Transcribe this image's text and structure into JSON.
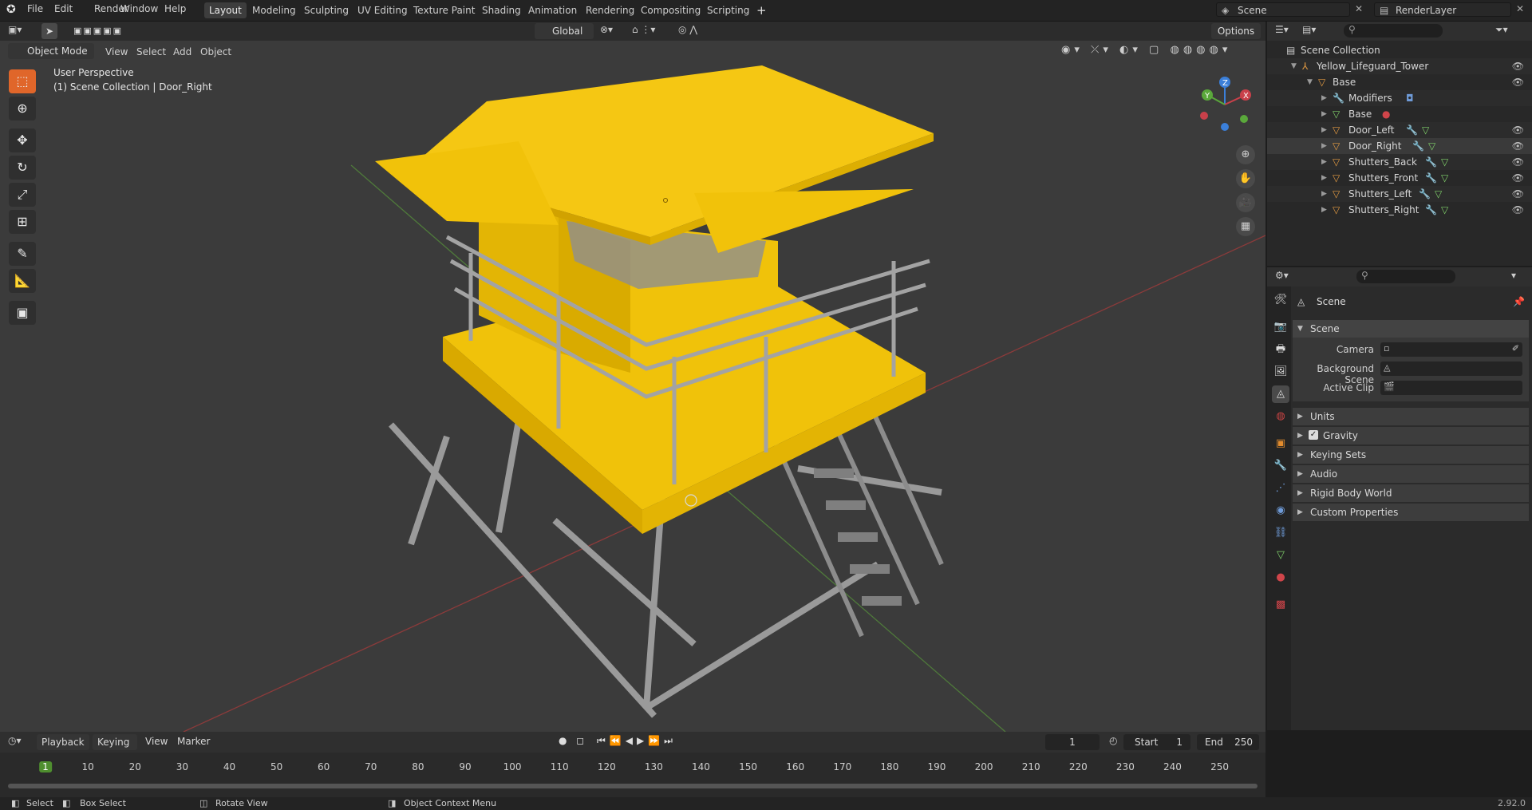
{
  "menu": {
    "items": [
      "File",
      "Edit",
      "Render",
      "Window",
      "Help"
    ]
  },
  "workspaces": {
    "tabs": [
      "Layout",
      "Modeling",
      "Sculpting",
      "UV Editing",
      "Texture Paint",
      "Shading",
      "Animation",
      "Rendering",
      "Compositing",
      "Scripting"
    ],
    "active": "Layout",
    "add": "+"
  },
  "scene_field": "Scene",
  "view_layer_field": "RenderLayer",
  "viewport_header": {
    "mode": "Object Mode",
    "menus": [
      "View",
      "Select",
      "Add",
      "Object"
    ],
    "transform_orientation": "Global",
    "options": "Options"
  },
  "viewport_overlay": {
    "perspective": "User Perspective",
    "collection": "(1) Scene Collection | Door_Right"
  },
  "gizmo": {
    "x": "X",
    "y": "Y",
    "z": "Z"
  },
  "outliner": {
    "rows": [
      {
        "label": "Scene Collection",
        "indent": 0,
        "eye": false,
        "color": "#c8c8c8"
      },
      {
        "label": "Yellow_Lifeguard_Tower",
        "indent": 1,
        "eye": true,
        "color": "#e29a42"
      },
      {
        "label": "Base",
        "indent": 2,
        "eye": true,
        "color": "#e29a42"
      },
      {
        "label": "Modifiers",
        "indent": 3,
        "eye": false,
        "color": "#6f9bd8"
      },
      {
        "label": "Base",
        "indent": 3,
        "eye": false,
        "color": "#7fcf6a"
      },
      {
        "label": "Door_Left",
        "indent": 3,
        "eye": true,
        "color": "#e29a42"
      },
      {
        "label": "Door_Right",
        "indent": 3,
        "eye": true,
        "color": "#e29a42"
      },
      {
        "label": "Shutters_Back",
        "indent": 3,
        "eye": true,
        "color": "#e29a42"
      },
      {
        "label": "Shutters_Front",
        "indent": 3,
        "eye": true,
        "color": "#e29a42"
      },
      {
        "label": "Shutters_Left",
        "indent": 3,
        "eye": true,
        "color": "#e29a42"
      },
      {
        "label": "Shutters_Right",
        "indent": 3,
        "eye": true,
        "color": "#e29a42"
      }
    ]
  },
  "properties": {
    "context": "Scene",
    "section": "Scene",
    "fields": [
      {
        "label": "Camera",
        "value": ""
      },
      {
        "label": "Background Scene",
        "value": ""
      },
      {
        "label": "Active Clip",
        "value": ""
      }
    ],
    "panels": [
      "Units",
      "Gravity",
      "Keying Sets",
      "Audio",
      "Rigid Body World",
      "Custom Properties"
    ]
  },
  "timeline": {
    "menus": [
      "Playback",
      "Keying",
      "View",
      "Marker"
    ],
    "current_frame": "1",
    "start_label": "Start",
    "start": "1",
    "end_label": "End",
    "end": "250",
    "ruler": [
      "1",
      "10",
      "20",
      "30",
      "40",
      "50",
      "60",
      "70",
      "80",
      "90",
      "100",
      "110",
      "120",
      "130",
      "140",
      "150",
      "160",
      "170",
      "180",
      "190",
      "200",
      "210",
      "220",
      "230",
      "240",
      "250"
    ]
  },
  "statusbar": {
    "select": "Select",
    "box_select": "Box Select",
    "rotate_view": "Rotate View",
    "context_menu": "Object Context Menu",
    "version": "2.92.0"
  }
}
